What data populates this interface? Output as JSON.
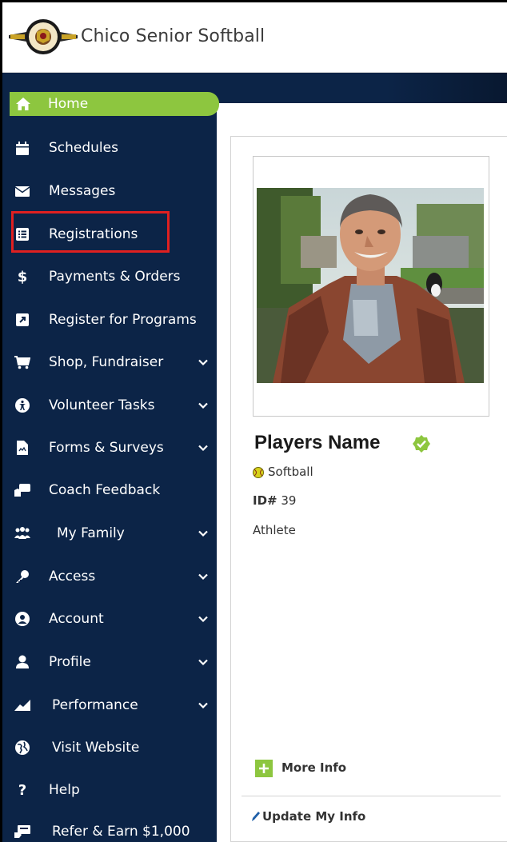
{
  "header": {
    "brand": "Chico Senior Softball",
    "logo_icon": "league-logo"
  },
  "colors": {
    "sidebar_bg": "#0c2447",
    "active_bg": "#8dc63f",
    "highlight_border": "#e02020"
  },
  "sidebar": {
    "items": [
      {
        "label": "Home",
        "icon": "home-icon",
        "active": true
      },
      {
        "label": "Schedules",
        "icon": "calendar-icon"
      },
      {
        "label": "Messages",
        "icon": "envelope-icon"
      },
      {
        "label": "Registrations",
        "icon": "list-icon",
        "highlighted": true
      },
      {
        "label": "Payments & Orders",
        "icon": "dollar-icon"
      },
      {
        "label": "Register for Programs",
        "icon": "external-link-icon"
      },
      {
        "label": "Shop, Fundraiser",
        "icon": "cart-icon",
        "expandable": true
      },
      {
        "label": "Volunteer Tasks",
        "icon": "volunteer-icon",
        "expandable": true
      },
      {
        "label": "Forms & Surveys",
        "icon": "document-icon",
        "expandable": true
      },
      {
        "label": "Coach Feedback",
        "icon": "feedback-icon"
      },
      {
        "label": "My Family",
        "icon": "family-icon",
        "expandable": true
      },
      {
        "label": "Access",
        "icon": "key-icon",
        "expandable": true
      },
      {
        "label": "Account",
        "icon": "user-circle-icon",
        "expandable": true
      },
      {
        "label": "Profile",
        "icon": "user-icon",
        "expandable": true
      },
      {
        "label": "Performance",
        "icon": "chart-icon",
        "expandable": true
      },
      {
        "label": "Visit Website",
        "icon": "globe-icon"
      },
      {
        "label": "Help",
        "icon": "question-icon"
      },
      {
        "label": "Refer & Earn $1,000",
        "icon": "refer-icon"
      }
    ]
  },
  "profile": {
    "name": "Players Name",
    "sport": "Softball",
    "id_label": "ID#",
    "id_value": "39",
    "role": "Athlete",
    "more_info_label": "More Info",
    "update_label": "Update My Info"
  }
}
